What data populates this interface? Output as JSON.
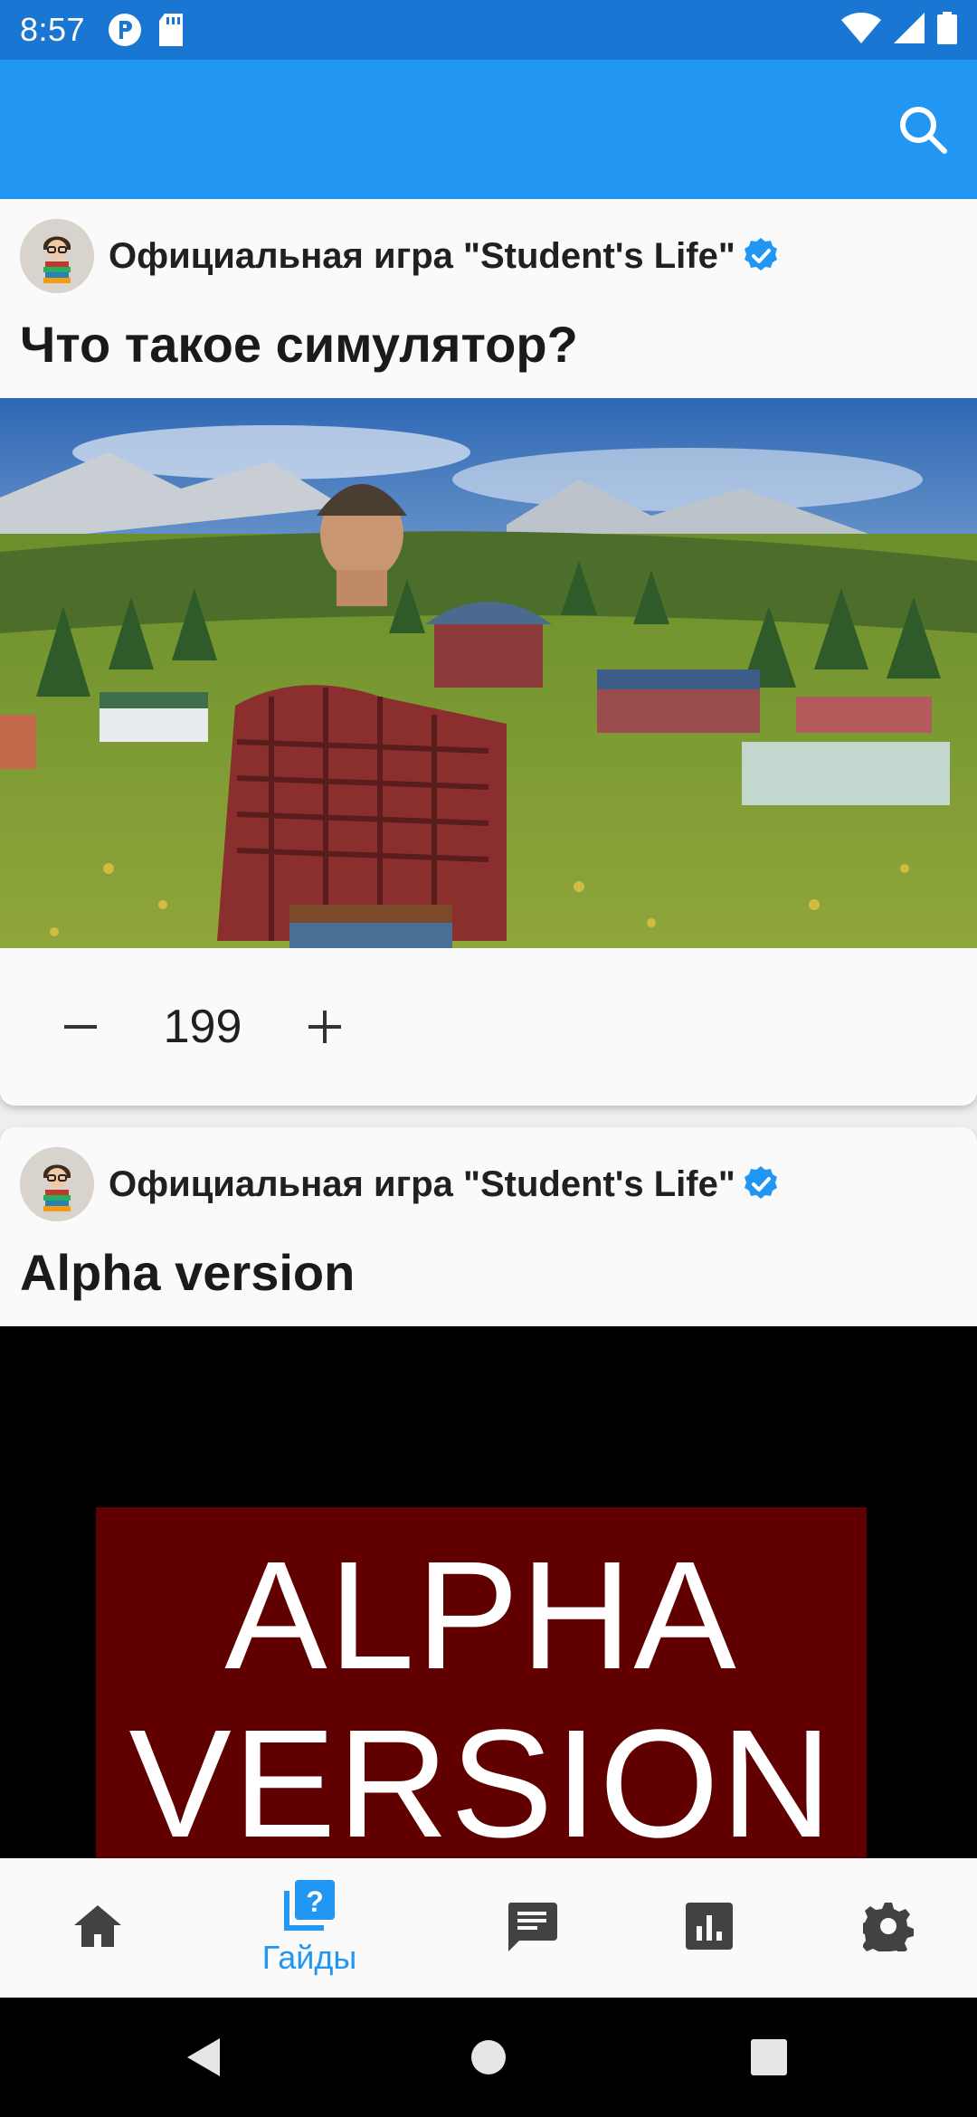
{
  "status_bar": {
    "time": "8:57",
    "icons": [
      "p-badge-icon",
      "sd-card-icon",
      "wifi-icon",
      "signal-icon",
      "battery-icon"
    ]
  },
  "app_bar": {
    "background": "#2196F3",
    "actions": [
      "search-icon"
    ]
  },
  "posts": [
    {
      "author": "Официальная игра \"Student's Life\"",
      "verified": true,
      "title": "Что такое симулятор?",
      "image": "farm-simulator-landscape",
      "votes": {
        "minus_icon": "minus-icon",
        "score": "199",
        "plus_icon": "plus-icon"
      }
    },
    {
      "author": "Официальная игра \"Student's Life\"",
      "verified": true,
      "title": "Alpha version",
      "image_text": {
        "line1": "ALPHA",
        "line2": "VERSION"
      }
    }
  ],
  "bottom_nav": {
    "active_color": "#2196F3",
    "items": [
      {
        "icon": "home-icon",
        "label": "",
        "active": false
      },
      {
        "icon": "guides-icon",
        "label": "Гайды",
        "active": true
      },
      {
        "icon": "chat-icon",
        "label": "",
        "active": false
      },
      {
        "icon": "stats-icon",
        "label": "",
        "active": false
      },
      {
        "icon": "settings-icon",
        "label": "",
        "active": false
      }
    ]
  },
  "system_nav": [
    "back-icon",
    "home-circle-icon",
    "recents-icon"
  ]
}
